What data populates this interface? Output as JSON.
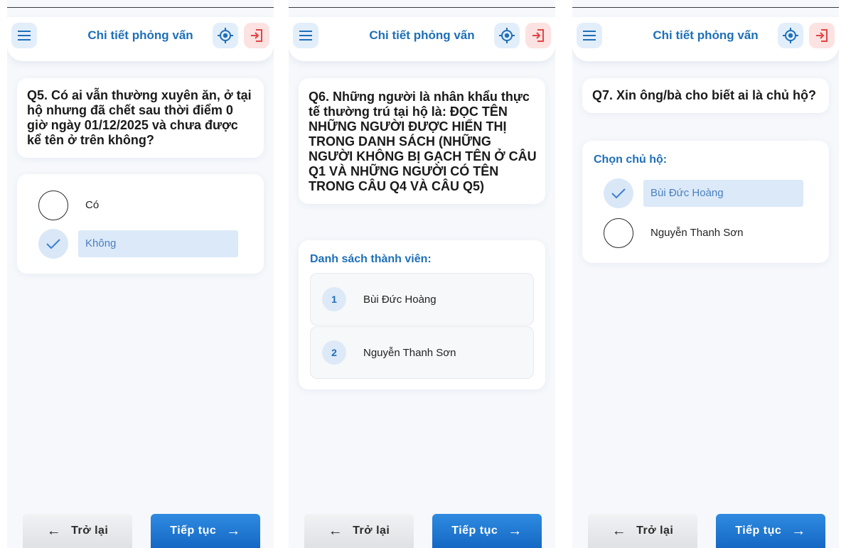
{
  "header": {
    "title": "Chi tiết phỏng vấn"
  },
  "nav": {
    "back_label": "Trở lại",
    "next_label": "Tiếp tục",
    "back_arrow": "←",
    "next_arrow": "→"
  },
  "screens": [
    {
      "question": "Q5. Có ai vẫn thường xuyên ăn, ở tại hộ nhưng đã chết sau thời điểm 0 giờ ngày 01/12/2025 và chưa được kể tên ở trên không?",
      "options": [
        {
          "label": "Có",
          "selected": false
        },
        {
          "label": "Không",
          "selected": true
        }
      ]
    },
    {
      "question": "Q6. Những người là nhân khẩu thực tế thường trú tại hộ là: ĐỌC TÊN NHỮNG NGƯỜI ĐƯỢC HIỂN THỊ TRONG DANH SÁCH (NHỮNG NGƯỜI KHÔNG BỊ GẠCH TÊN Ở CÂU Q1 VÀ NHỮNG NGƯỜI CÓ TÊN TRONG CÂU Q4 VÀ CÂU Q5)",
      "list_title": "Danh sách thành viên:",
      "members": [
        {
          "num": "1",
          "name": "Bùi Đức Hoàng"
        },
        {
          "num": "2",
          "name": "Nguyễn Thanh Sơn"
        }
      ]
    },
    {
      "question": "Q7. Xin ông/bà cho biết ai là chủ hộ?",
      "list_title": "Chọn chủ hộ:",
      "options": [
        {
          "label": "Bùi Đức Hoàng",
          "selected": true
        },
        {
          "label": "Nguyễn Thanh Sơn",
          "selected": false
        }
      ]
    }
  ],
  "colors": {
    "accent": "#1e6fb8",
    "selected_bg": "#dce9f8",
    "danger_bg": "#fde2e2",
    "next_button": "#1e7ad6"
  }
}
